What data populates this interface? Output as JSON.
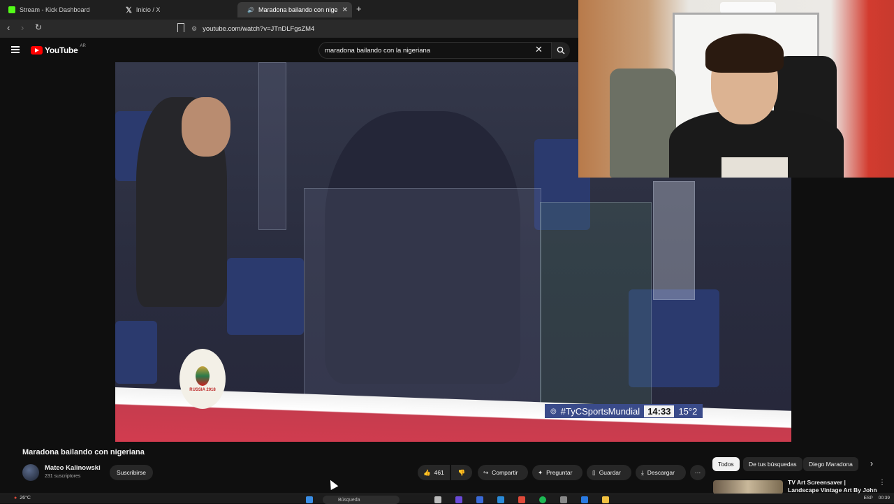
{
  "browser": {
    "tabs": [
      {
        "label": "Stream - Kick Dashboard",
        "active": false,
        "color": "#53fc18"
      },
      {
        "label": "Inicio / X",
        "active": false,
        "color": "#ffffff"
      },
      {
        "label": "Maradona bailando con nige",
        "active": true,
        "color": "#ff0000"
      }
    ],
    "new_tab": "+",
    "url": "youtube.com/watch?v=JTnDLFgsZM4"
  },
  "youtube": {
    "logo_text": "YouTube",
    "country": "AR",
    "search_value": "maradona bailando con la nigeriana",
    "video": {
      "overlay_hashtag": "#TyCSportsMundial",
      "overlay_clock": "14:33",
      "overlay_temp": "15°2",
      "badge_text": "RUSSIA 2018"
    },
    "title": "Maradona bailando con nigeriana",
    "channel": "Mateo Kalinowski",
    "subscribers": "231 suscriptores",
    "subscribe_label": "Suscribirse",
    "likes": "461",
    "actions": {
      "share": "Compartir",
      "ask": "Preguntar",
      "save": "Guardar",
      "download": "Descargar"
    },
    "chips": [
      "Todos",
      "De tus búsquedas",
      "Diego Maradona"
    ],
    "recommendation_title": "TV Art Screensaver | Landscape Vintage Art By John Frederick"
  },
  "taskbar": {
    "temperature": "26°C",
    "search_placeholder": "Búsqueda",
    "lang": "ESP",
    "time": "00:39"
  },
  "colors": {
    "yt_bg": "#0f0f0f",
    "yt_red": "#ff0000",
    "chip_bg": "#272727"
  }
}
